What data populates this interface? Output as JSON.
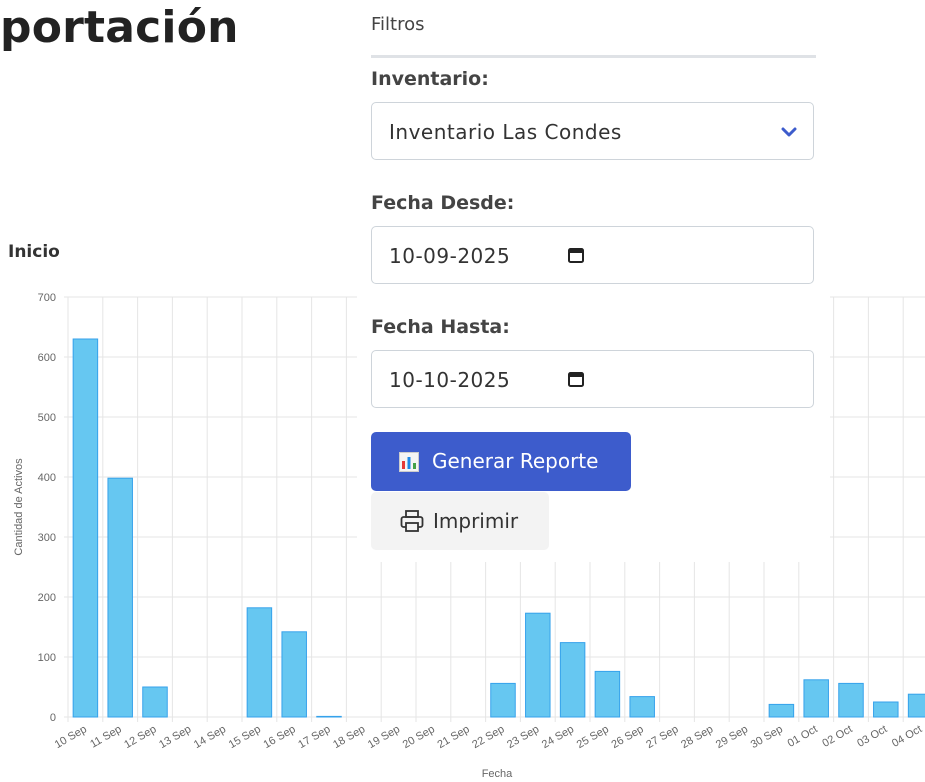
{
  "page": {
    "title": "portación"
  },
  "filters": {
    "title": "Filtros",
    "inventory": {
      "label": "Inventario:",
      "selected": "Inventario Las Condes",
      "icon": "chevron-down-icon"
    },
    "date_from": {
      "label": "Fecha Desde:",
      "value": "10-09-2025",
      "icon": "calendar-icon"
    },
    "date_to": {
      "label": "Fecha Hasta:",
      "value": "10-10-2025",
      "icon": "calendar-icon"
    },
    "generate_button": {
      "label": "Generar Reporte",
      "icon": "bar-chart-icon"
    },
    "print_button": {
      "label": "Imprimir",
      "icon": "printer-icon"
    }
  },
  "colors": {
    "primary_button": "#3d5ccc",
    "bar_fill": "#66c7f1",
    "bar_border": "#36a2eb"
  },
  "chart_data": {
    "type": "bar",
    "title": "Inicio",
    "xlabel": "Fecha",
    "ylabel": "Cantidad de Activos",
    "ylim": [
      0,
      700
    ],
    "yticks": [
      0,
      100,
      200,
      300,
      400,
      500,
      600,
      700
    ],
    "grid": true,
    "categories": [
      "10 Sep",
      "11 Sep",
      "12 Sep",
      "13 Sep",
      "14 Sep",
      "15 Sep",
      "16 Sep",
      "17 Sep",
      "18 Sep",
      "19 Sep",
      "20 Sep",
      "21 Sep",
      "22 Sep",
      "23 Sep",
      "24 Sep",
      "25 Sep",
      "26 Sep",
      "27 Sep",
      "28 Sep",
      "29 Sep",
      "30 Sep",
      "01 Oct",
      "02 Oct",
      "03 Oct",
      "04 Oct"
    ],
    "values": [
      630,
      398,
      50,
      0,
      0,
      182,
      142,
      1,
      0,
      0,
      0,
      0,
      56,
      173,
      124,
      76,
      34,
      0,
      0,
      0,
      21,
      62,
      56,
      25,
      38
    ]
  }
}
